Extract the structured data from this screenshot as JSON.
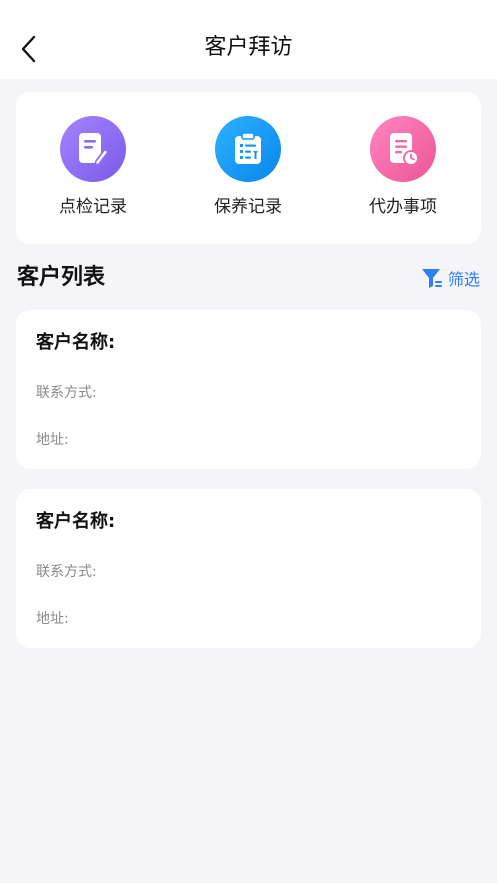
{
  "header": {
    "title": "客户拜访"
  },
  "quick_actions": [
    {
      "label": "点检记录",
      "icon": "edit-document-icon",
      "color": "#8b6cf0"
    },
    {
      "label": "保养记录",
      "icon": "clipboard-wrench-icon",
      "color": "#1a97f5"
    },
    {
      "label": "代办事项",
      "icon": "document-clock-icon",
      "color": "#f266a8"
    }
  ],
  "customer_list": {
    "title": "客户列表",
    "filter_label": "筛选",
    "items": [
      {
        "name_label": "客户名称:",
        "contact_label": "联系方式:",
        "address_label": "地址:"
      },
      {
        "name_label": "客户名称:",
        "contact_label": "联系方式:",
        "address_label": "地址:"
      }
    ]
  },
  "colors": {
    "accent": "#2d7ff9",
    "background": "#f4f4f9"
  }
}
